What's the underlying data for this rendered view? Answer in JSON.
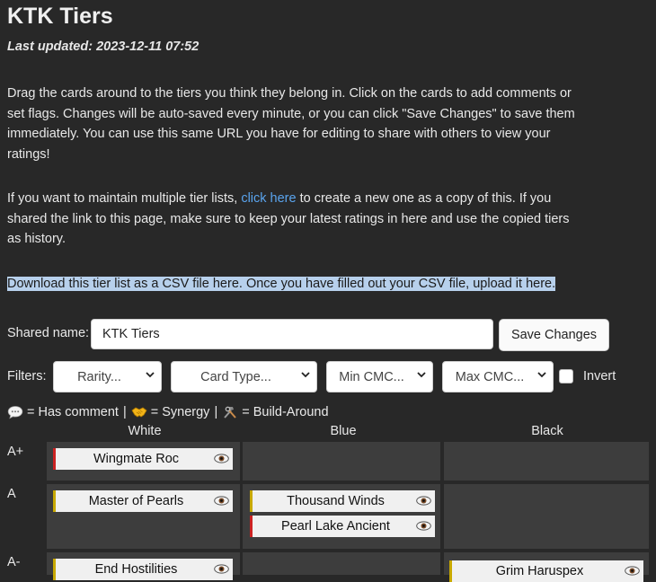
{
  "header": {
    "title": "KTK Tiers",
    "last_updated": "Last updated: 2023-12-11 07:52"
  },
  "intro": {
    "p1": "Drag the cards around to the tiers you think they belong in. Click on the cards to add comments or set flags. Changes will be auto-saved every minute, or you can click \"Save Changes\" to save them immediately. You can use this same URL you have for editing to share with others to view your ratings!",
    "p2_before": "If you want to maintain multiple tier lists, ",
    "p2_link": "click here",
    "p2_after": " to create a new one as a copy of this. If you shared the link to this page, make sure to keep your latest ratings in here and use the copied tiers as history.",
    "p3": "Download this tier list as a CSV file here. Once you have filled out your CSV file, upload it here."
  },
  "shared": {
    "label": "Shared name:",
    "value": "KTK Tiers",
    "save_button": "Save Changes"
  },
  "filters": {
    "label": "Filters:",
    "rarity": "Rarity...",
    "card_type": "Card Type...",
    "min_cmc": "Min CMC...",
    "max_cmc": "Max CMC...",
    "invert": "Invert",
    "invert_checked": false
  },
  "legend": {
    "comment": "= Has comment",
    "synergy": "= Synergy",
    "build_around": "= Build-Around",
    "separator": "|"
  },
  "columns": [
    "White",
    "Blue",
    "Black"
  ],
  "tiers": [
    {
      "label": "A+",
      "cells": [
        [
          {
            "name": "Wingmate Roc",
            "rarity": "mythic"
          }
        ],
        [],
        []
      ]
    },
    {
      "label": "A",
      "cells": [
        [
          {
            "name": "Master of Pearls",
            "rarity": "rare"
          }
        ],
        [
          {
            "name": "Thousand Winds",
            "rarity": "rare"
          },
          {
            "name": "Pearl Lake Ancient",
            "rarity": "mythic"
          }
        ],
        []
      ]
    },
    {
      "label": "A-",
      "cells": [
        [
          {
            "name": "End Hostilities",
            "rarity": "rare"
          }
        ],
        [],
        [
          {
            "name": "Grim Haruspex",
            "rarity": "rare"
          }
        ]
      ]
    }
  ],
  "colors": {
    "background": "#282828",
    "cell": "#3d3d3d",
    "link": "#5aa4ee",
    "highlight": "#b7d0ec",
    "mythic_border": "#cc2222",
    "rare_border": "#c8a900"
  }
}
